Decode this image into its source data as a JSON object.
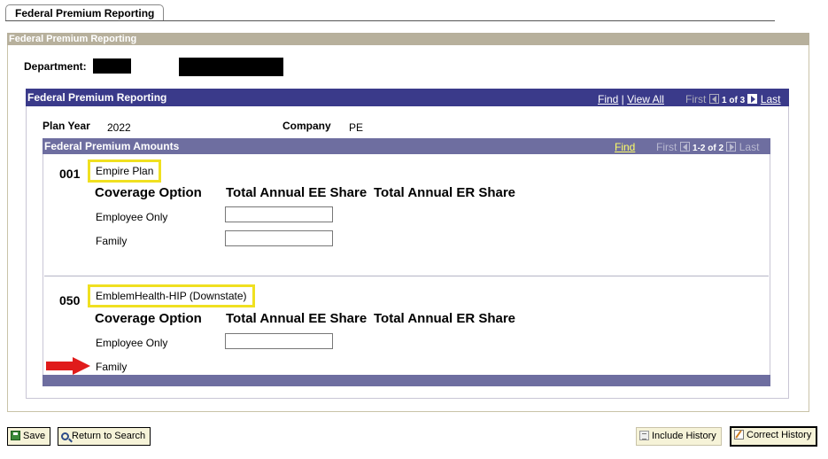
{
  "tab": {
    "label": "Federal Premium Reporting"
  },
  "page": {
    "header": "Federal Premium Reporting",
    "department_label": "Department:"
  },
  "grid": {
    "title": "Federal Premium Reporting",
    "find": "Find",
    "view_all": "View All",
    "first": "First",
    "count": "1 of 3",
    "last": "Last",
    "plan_year_label": "Plan Year",
    "plan_year_value": "2022",
    "company_label": "Company",
    "company_value": "PE"
  },
  "amounts": {
    "title": "Federal Premium Amounts",
    "find": "Find",
    "first": "First",
    "count": "1-2 of 2",
    "last": "Last",
    "plans": [
      {
        "code": "001",
        "name": "Empire Plan",
        "col_coverage": "Coverage Option",
        "col_ee": "Total Annual EE Share",
        "col_er": "Total Annual ER Share",
        "rows": [
          {
            "label": "Employee Only",
            "ee_value": ""
          },
          {
            "label": "Family",
            "ee_value": ""
          }
        ]
      },
      {
        "code": "050",
        "name": "EmblemHealth-HIP (Downstate)",
        "col_coverage": "Coverage Option",
        "col_ee": "Total Annual EE Share",
        "col_er": "Total Annual ER Share",
        "rows": [
          {
            "label": "Employee Only",
            "ee_value": ""
          },
          {
            "label": "Family",
            "ee_value": ""
          }
        ]
      }
    ]
  },
  "buttons": {
    "save": "Save",
    "return_to_search": "Return to Search",
    "include_history": "Include History",
    "correct_history": "Correct History"
  },
  "colors": {
    "grid_header": "#3a3a8a",
    "sub_header": "#6e6ea0",
    "page_header": "#b7b09c",
    "highlight": "#f0e020",
    "arrow": "#e01b1b"
  }
}
